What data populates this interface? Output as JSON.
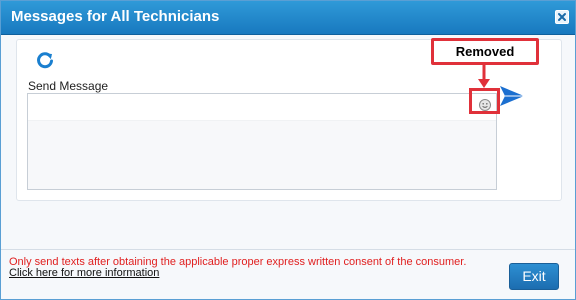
{
  "dialog": {
    "title": "Messages for All Technicians",
    "close_icon": "close-icon"
  },
  "panel": {
    "refresh_icon": "refresh-icon",
    "send_message_label": "Send Message",
    "message_value": "",
    "emoji_icon": "smiley-icon",
    "send_icon": "send-arrow-icon"
  },
  "annotation": {
    "label": "Removed",
    "color": "#e0313a"
  },
  "footer": {
    "consent_text": "Only send texts after obtaining the applicable proper express written consent of the consumer.",
    "more_info_link": "Click here for more information",
    "exit_label": "Exit"
  },
  "colors": {
    "titlebar": "#1f86c9",
    "accent": "#1879bf",
    "warning_text": "#e01f1f"
  }
}
